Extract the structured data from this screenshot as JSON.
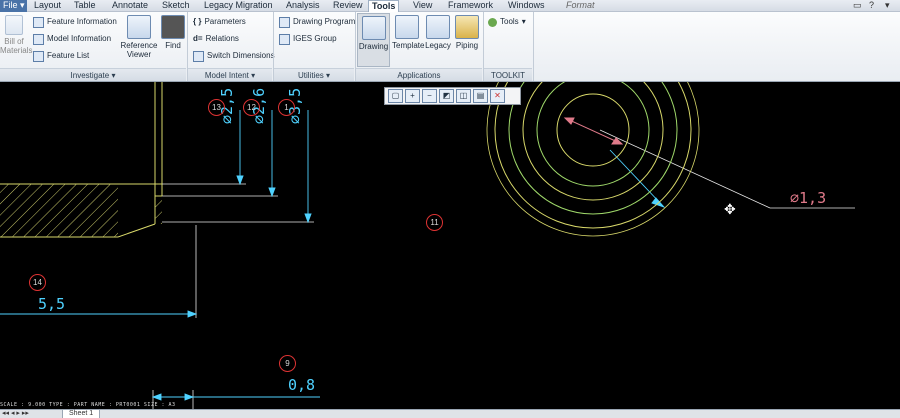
{
  "menu": {
    "file": "File",
    "tabs": [
      "Layout",
      "Table",
      "Annotate",
      "Sketch",
      "Legacy Migration",
      "Analysis",
      "Review",
      "Tools",
      "View",
      "Framework",
      "Windows"
    ],
    "active_tab": "Tools",
    "format": "Format"
  },
  "ribbon": {
    "investigate": {
      "bill_of_materials": "Bill of Materials",
      "feature_information": "Feature Information",
      "model_information": "Model Information",
      "feature_list": "Feature List",
      "reference_viewer": "Reference Viewer",
      "find": "Find",
      "label": "Investigate"
    },
    "model_intent": {
      "parameters": "Parameters",
      "relations": "Relations",
      "switch_dimensions": "Switch Dimensions",
      "label": "Model Intent"
    },
    "utilities": {
      "drawing_program": "Drawing Program",
      "iges_group": "IGES Group",
      "label": "Utilities"
    },
    "applications": {
      "drawing": "Drawing",
      "template": "Template",
      "legacy": "Legacy",
      "piping": "Piping",
      "label": "Applications"
    },
    "toolkit": {
      "tools": "Tools",
      "label": "TOOLKIT"
    }
  },
  "drawing": {
    "dimensions": {
      "d_left": "⌀2,5",
      "d_mid": "⌀2,6",
      "d_right": "⌀3,5",
      "diameter_callout": "⌀1,3",
      "horizontal_55": "5,5",
      "horizontal_08": "0,8"
    },
    "balloons": {
      "b13": "13",
      "b12": "12",
      "b1": "1",
      "b11": "11",
      "b14": "14",
      "b9": "9"
    }
  },
  "status": {
    "sheet": "Sheet 1",
    "scale_text": "SCALE : 9.000  TYPE : PART  NAME : PRT0001  SIZE : A3"
  }
}
